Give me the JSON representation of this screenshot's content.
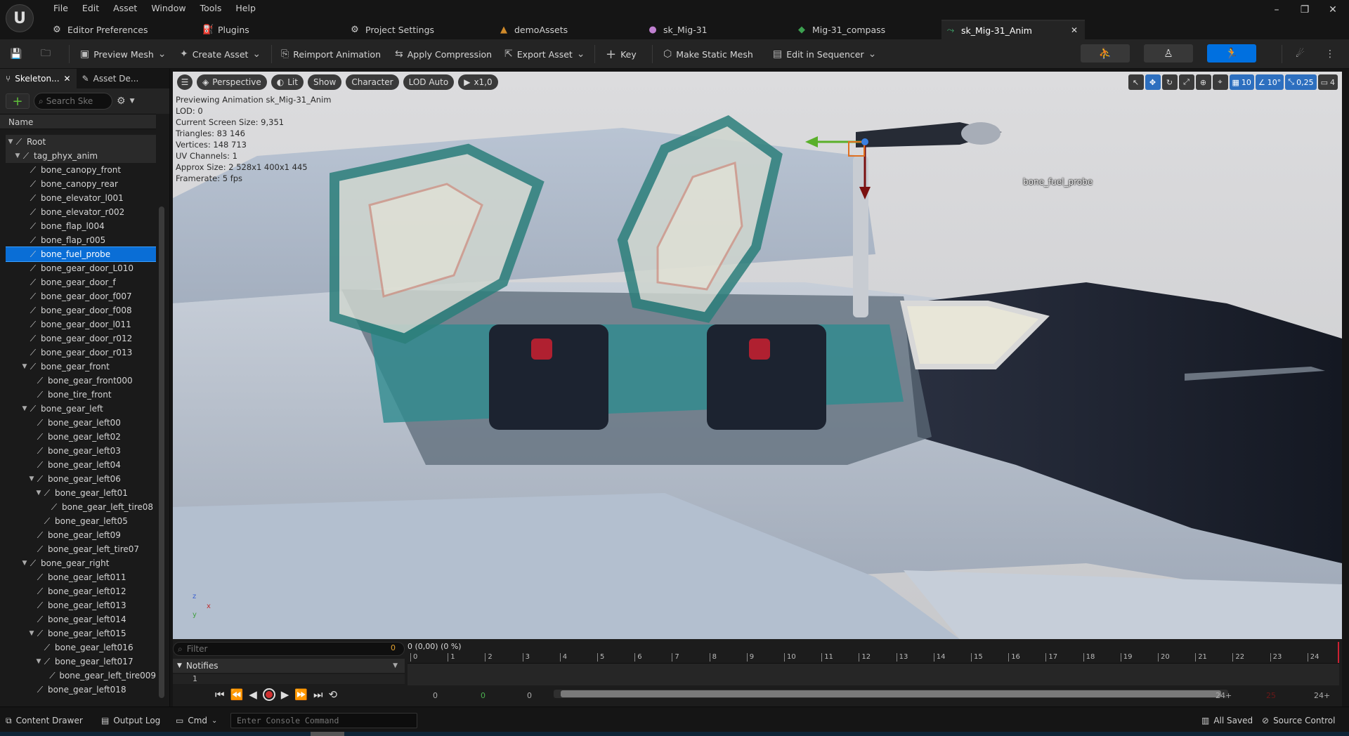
{
  "menu": [
    "File",
    "Edit",
    "Asset",
    "Window",
    "Tools",
    "Help"
  ],
  "tabs": [
    {
      "label": "Editor Preferences",
      "icon": "sliders-icon"
    },
    {
      "label": "Plugins",
      "icon": "plug-icon"
    },
    {
      "label": "Project Settings",
      "icon": "gear-icon"
    },
    {
      "label": "demoAssets",
      "icon": "folder-icon"
    },
    {
      "label": "sk_Mig-31",
      "icon": "skeletal-mesh-icon"
    },
    {
      "label": "Mig-31_compass",
      "icon": "mesh-icon"
    },
    {
      "label": "sk_Mig-31_Anim",
      "icon": "animation-icon"
    }
  ],
  "toolbar": {
    "preview_mesh": "Preview Mesh",
    "create_asset": "Create Asset",
    "reimport": "Reimport Animation",
    "apply_compression": "Apply Compression",
    "export_asset": "Export Asset",
    "key": "Key",
    "make_static_mesh": "Make Static Mesh",
    "edit_in_sequencer": "Edit in Sequencer"
  },
  "panel": {
    "tab_skeleton": "Skeleton...",
    "tab_asset": "Asset De...",
    "search_placeholder": "Search Ske",
    "header": "Name"
  },
  "tree": [
    {
      "label": "Root",
      "depth": 0,
      "exp": "▼",
      "dark": true
    },
    {
      "label": "tag_phyx_anim",
      "depth": 1,
      "exp": "▼",
      "dark": true
    },
    {
      "label": "bone_canopy_front",
      "depth": 2,
      "exp": ""
    },
    {
      "label": "bone_canopy_rear",
      "depth": 2,
      "exp": ""
    },
    {
      "label": "bone_elevator_l001",
      "depth": 2,
      "exp": ""
    },
    {
      "label": "bone_elevator_r002",
      "depth": 2,
      "exp": ""
    },
    {
      "label": "bone_flap_l004",
      "depth": 2,
      "exp": ""
    },
    {
      "label": "bone_flap_r005",
      "depth": 2,
      "exp": ""
    },
    {
      "label": "bone_fuel_probe",
      "depth": 2,
      "exp": "",
      "selected": true
    },
    {
      "label": "bone_gear_door_L010",
      "depth": 2,
      "exp": ""
    },
    {
      "label": "bone_gear_door_f",
      "depth": 2,
      "exp": ""
    },
    {
      "label": "bone_gear_door_f007",
      "depth": 2,
      "exp": ""
    },
    {
      "label": "bone_gear_door_f008",
      "depth": 2,
      "exp": ""
    },
    {
      "label": "bone_gear_door_l011",
      "depth": 2,
      "exp": ""
    },
    {
      "label": "bone_gear_door_r012",
      "depth": 2,
      "exp": ""
    },
    {
      "label": "bone_gear_door_r013",
      "depth": 2,
      "exp": ""
    },
    {
      "label": "bone_gear_front",
      "depth": 2,
      "exp": "▼"
    },
    {
      "label": "bone_gear_front000",
      "depth": 3,
      "exp": ""
    },
    {
      "label": "bone_tire_front",
      "depth": 3,
      "exp": ""
    },
    {
      "label": "bone_gear_left",
      "depth": 2,
      "exp": "▼"
    },
    {
      "label": "bone_gear_left00",
      "depth": 3,
      "exp": ""
    },
    {
      "label": "bone_gear_left02",
      "depth": 3,
      "exp": ""
    },
    {
      "label": "bone_gear_left03",
      "depth": 3,
      "exp": ""
    },
    {
      "label": "bone_gear_left04",
      "depth": 3,
      "exp": ""
    },
    {
      "label": "bone_gear_left06",
      "depth": 3,
      "exp": "▼"
    },
    {
      "label": "bone_gear_left01",
      "depth": 4,
      "exp": "▼"
    },
    {
      "label": "bone_gear_left_tire08",
      "depth": 5,
      "exp": ""
    },
    {
      "label": "bone_gear_left05",
      "depth": 4,
      "exp": ""
    },
    {
      "label": "bone_gear_left09",
      "depth": 3,
      "exp": ""
    },
    {
      "label": "bone_gear_left_tire07",
      "depth": 3,
      "exp": ""
    },
    {
      "label": "bone_gear_right",
      "depth": 2,
      "exp": "▼"
    },
    {
      "label": "bone_gear_left011",
      "depth": 3,
      "exp": ""
    },
    {
      "label": "bone_gear_left012",
      "depth": 3,
      "exp": ""
    },
    {
      "label": "bone_gear_left013",
      "depth": 3,
      "exp": ""
    },
    {
      "label": "bone_gear_left014",
      "depth": 3,
      "exp": ""
    },
    {
      "label": "bone_gear_left015",
      "depth": 3,
      "exp": "▼"
    },
    {
      "label": "bone_gear_left016",
      "depth": 4,
      "exp": ""
    },
    {
      "label": "bone_gear_left017",
      "depth": 4,
      "exp": "▼"
    },
    {
      "label": "bone_gear_left_tire009",
      "depth": 5,
      "exp": ""
    },
    {
      "label": "bone_gear_left018",
      "depth": 3,
      "exp": ""
    }
  ],
  "viewport": {
    "menu_icon": "hamburger-icon",
    "perspective": "Perspective",
    "lit": "Lit",
    "show": "Show",
    "character": "Character",
    "lod": "LOD Auto",
    "speed": "x1,0",
    "grid_size": "10",
    "rot_snap": "10°",
    "scale_snap": "0,25",
    "camera_speed": "4",
    "info": [
      "Previewing Animation sk_Mig-31_Anim",
      "LOD: 0",
      "Current Screen Size: 9,351",
      "Triangles: 83 146",
      "Vertices: 148 713",
      "UV Channels: 1",
      "Approx Size: 2 528x1 400x1 445",
      "Framerate: 5 fps"
    ],
    "bone_label": "bone_fuel_probe",
    "axis_x": "x",
    "axis_z": "z",
    "axis_y": "y"
  },
  "timeline": {
    "filter_placeholder": "Filter",
    "count": "0",
    "notifies": "Notifies",
    "track": "1",
    "head": "0 (0,00) (0 %)",
    "ticks": [
      "0",
      "1",
      "2",
      "3",
      "4",
      "5",
      "6",
      "7",
      "8",
      "9",
      "10",
      "11",
      "12",
      "13",
      "14",
      "15",
      "16",
      "17",
      "18",
      "19",
      "20",
      "21",
      "22",
      "23",
      "24"
    ],
    "frame_start": "0",
    "frame_current": "0",
    "frame_end_left": "0",
    "frame_end": "24+",
    "frame_mid": "25",
    "frame_end2": "24+"
  },
  "status": {
    "content_drawer": "Content Drawer",
    "output_log": "Output Log",
    "cmd": "Cmd",
    "console_placeholder": "Enter Console Command",
    "all_saved": "All Saved",
    "source_control": "Source Control"
  },
  "colors": {
    "accent": "#0070e0",
    "selected_row": "#0a6ed6",
    "fuselage_light": "#b9c3cf",
    "fuselage_dark": "#1e2433",
    "canopy_teal": "#2f8f8a"
  }
}
